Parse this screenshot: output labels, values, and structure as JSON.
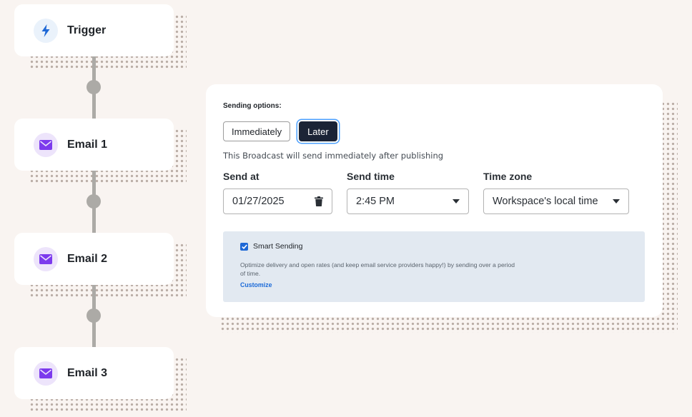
{
  "flow": {
    "nodes": [
      {
        "label": "Trigger",
        "icon": "lightning-bolt-icon"
      },
      {
        "label": "Email 1",
        "icon": "envelope-icon"
      },
      {
        "label": "Email 2",
        "icon": "envelope-icon"
      },
      {
        "label": "Email 3",
        "icon": "envelope-icon"
      }
    ]
  },
  "panel": {
    "options_title": "Sending options:",
    "immediately_label": "Immediately",
    "later_label": "Later",
    "helper_text": "This Broadcast will send immediately after publishing",
    "send_at": {
      "label": "Send at",
      "value": "01/27/2025"
    },
    "send_time": {
      "label": "Send time",
      "value": "2:45 PM"
    },
    "time_zone": {
      "label": "Time zone",
      "value": "Workspace's local time"
    },
    "smart_sending": {
      "label": "Smart Sending",
      "checked": true,
      "description": "Optimize delivery and open rates (and keep email service providers happy!) by sending over a period of time.",
      "link": "Customize"
    }
  },
  "colors": {
    "background": "#f9f4f1",
    "accent_blue": "#1e68d6",
    "dark_button": "#1b2436",
    "email_icon": "#7c3aed",
    "trigger_icon": "#1e68d6"
  }
}
